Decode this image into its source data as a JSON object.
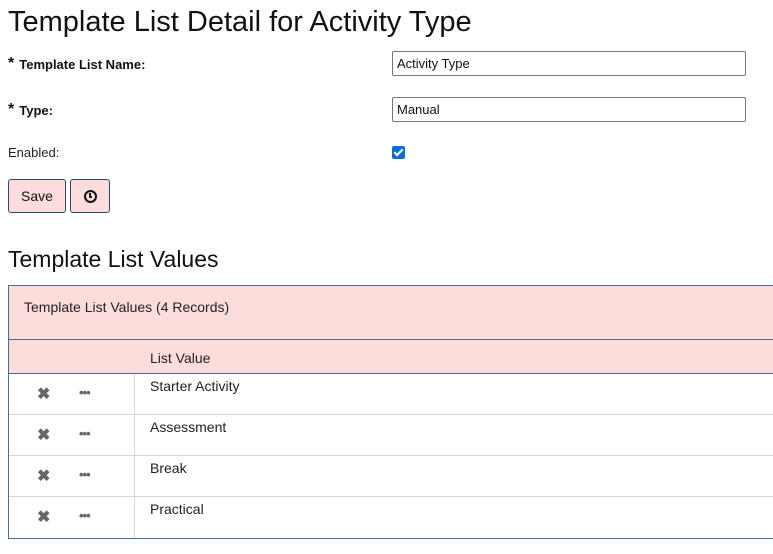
{
  "page": {
    "title": "Template List Detail for Activity Type"
  },
  "form": {
    "name_label": "Template List Name:",
    "name_value": "Activity Type",
    "type_label": "Type:",
    "type_value": "Manual",
    "enabled_label": "Enabled:",
    "enabled_checked": true,
    "required_marker": "*"
  },
  "buttons": {
    "save": "Save",
    "history_icon": "clock-icon"
  },
  "values_section": {
    "title": "Template List Values",
    "panel_header": "Template List Values (4 Records)",
    "column_header": "List Value",
    "delete_glyph": "✖",
    "more_glyph": "•••",
    "rows": [
      {
        "value": "Starter Activity"
      },
      {
        "value": "Assessment"
      },
      {
        "value": "Break"
      },
      {
        "value": "Practical"
      }
    ]
  },
  "colors": {
    "accent_bg": "#fddcdc",
    "border": "#4a6d96",
    "checkbox": "#0b6ed8"
  }
}
